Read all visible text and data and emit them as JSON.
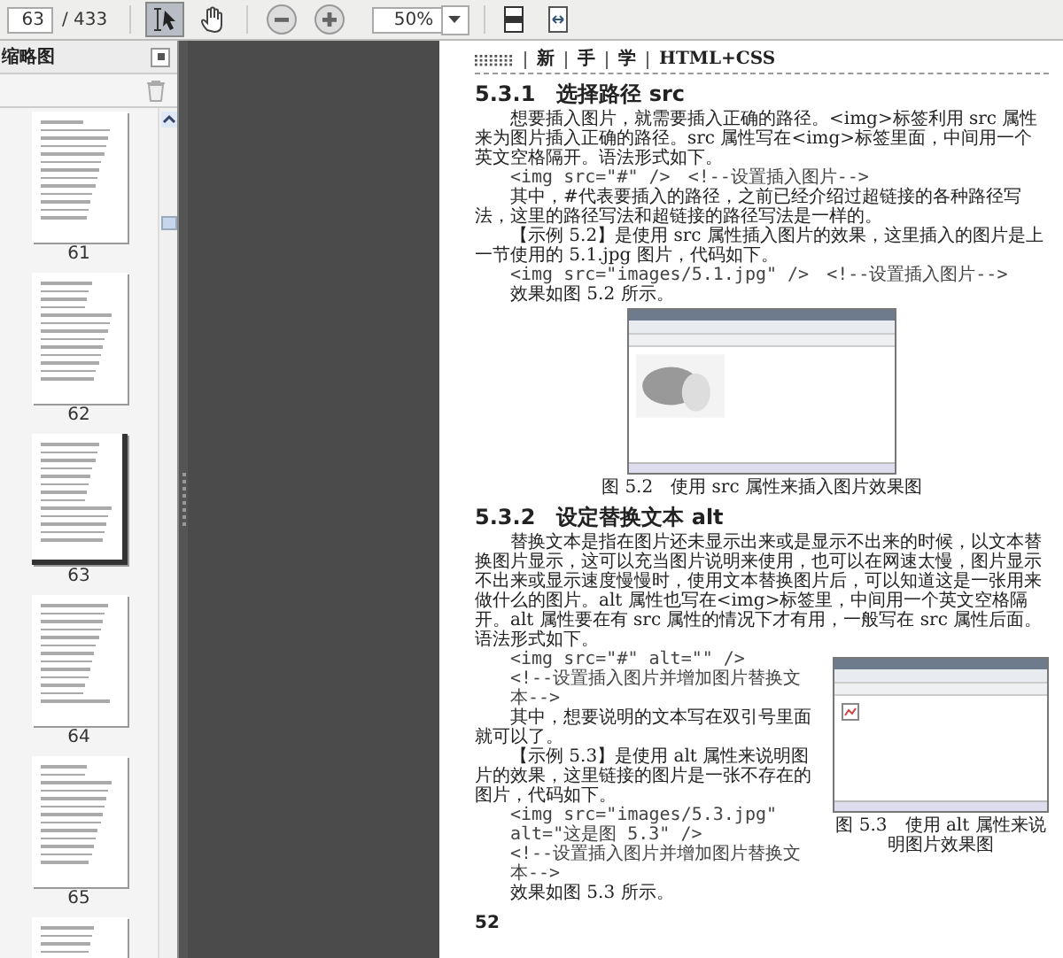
{
  "toolbar": {
    "page_number": "63",
    "page_count": "/ 433",
    "tools": [
      {
        "kind": "select",
        "selected": true
      },
      {
        "kind": "hand",
        "selected": false
      }
    ],
    "zoom": "50%"
  },
  "sidebar": {
    "title": "缩略图",
    "thumbnails": [
      {
        "label": "61",
        "selected": false
      },
      {
        "label": "62",
        "selected": false
      },
      {
        "label": "63",
        "selected": true
      },
      {
        "label": "64",
        "selected": false
      },
      {
        "label": "65",
        "selected": false
      },
      {
        "selected": false
      }
    ]
  },
  "page": {
    "header": [
      "新",
      "手",
      "学",
      "HTML+CSS"
    ],
    "blocks": [
      {
        "kind": "heading",
        "text": "5.3.1　选择路径 src"
      },
      {
        "kind": "paragraph",
        "text": "想要插入图片，就需要插入正确的路径。<img>标签利用 src 属性来为图片插入正确的路径。src 属性写在<img>标签里面，中间用一个英文空格隔开。语法形式如下。"
      },
      {
        "kind": "code",
        "code": "<img src=\"#\" />",
        "comment": "<!--设置插入图片-->"
      },
      {
        "kind": "paragraph",
        "text": "其中，#代表要插入的路径，之前已经介绍过超链接的各种路径写法，这里的路径写法和超链接的路径写法是一样的。"
      },
      {
        "kind": "paragraph",
        "text": "【示例 5.2】是使用 src 属性插入图片的效果，这里插入的图片是上一节使用的 5.1.jpg 图片，代码如下。"
      },
      {
        "kind": "code",
        "code": "<img src=\"images/5.1.jpg\" />",
        "comment": "<!--设置插入图片-->"
      },
      {
        "kind": "paragraph",
        "text": "效果如图 5.2 所示。"
      },
      {
        "kind": "figure",
        "caption": "图 5.2　使用 src 属性来插入图片效果图"
      },
      {
        "kind": "heading",
        "text": "5.3.2　设定替换文本 alt"
      },
      {
        "kind": "paragraph",
        "text": "替换文本是指在图片还未显示出来或是显示不出来的时候，以文本替换图片显示，这可以充当图片说明来使用，也可以在网速太慢，图片显示不出来或显示速度慢慢时，使用文本替换图片后，可以知道这是一张用来做什么的图片。alt 属性也写在<img>标签里，中间用一个英文空格隔开。alt 属性要在有 src 属性的情况下才有用，一般写在 src 属性后面。语法形式如下。"
      },
      {
        "kind": "code",
        "code": "<img src=\"#\" alt=\"\" />",
        "comment": "<!--设置插入图片并增加图片替换文本-->"
      },
      {
        "kind": "paragraph",
        "text": "其中，想要说明的文本写在双引号里面就可以了。"
      },
      {
        "kind": "paragraph",
        "text": "【示例 5.3】是使用 alt 属性来说明图片的效果，这里链接的图片是一张不存在的图片，代码如下。"
      },
      {
        "kind": "code",
        "code": "<img src=\"images/5.3.jpg\" alt=\"这是图 5.3\" />",
        "comment": "<!--设置插入图片并增加图片替换文本-->"
      },
      {
        "kind": "paragraph",
        "text": "效果如图 5.3 所示。"
      },
      {
        "kind": "side_figure",
        "caption": "图 5.3　使用 alt 属性来说明图片效果图"
      }
    ],
    "page_number": "52"
  }
}
